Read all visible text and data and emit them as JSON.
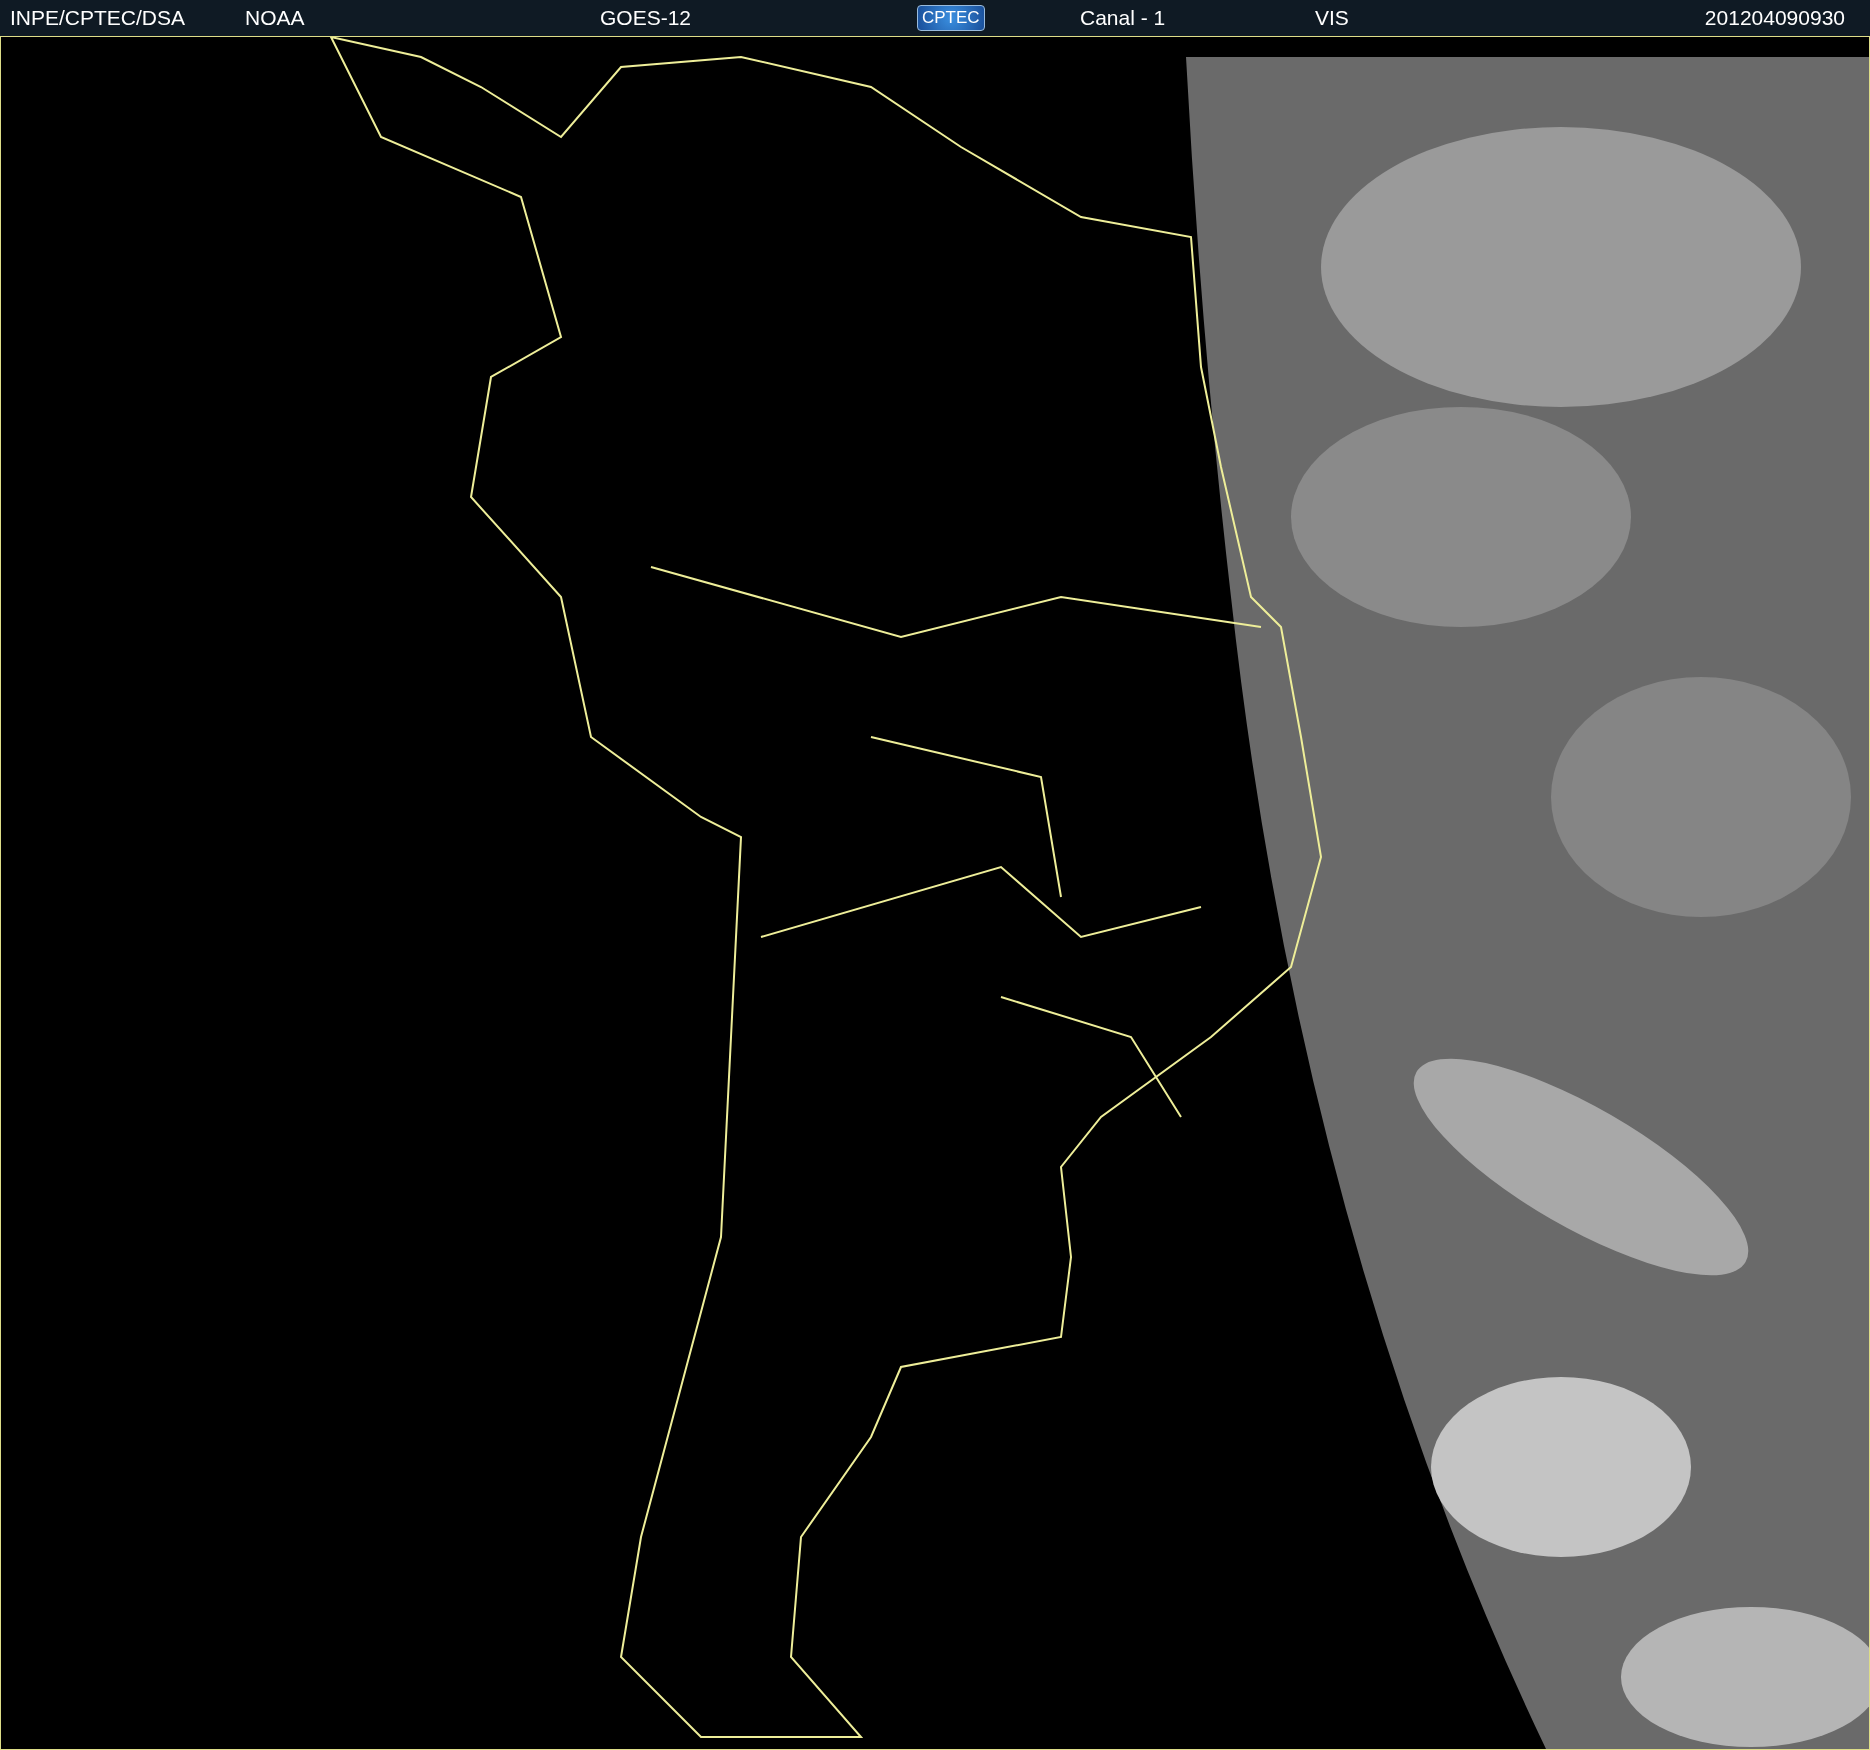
{
  "header": {
    "source": "INPE/CPTEC/DSA",
    "agency": "NOAA",
    "satellite": "GOES-12",
    "logo_text": "CPTEC",
    "channel": "Canal - 1",
    "band": "VIS",
    "timestamp": "201204090930"
  }
}
